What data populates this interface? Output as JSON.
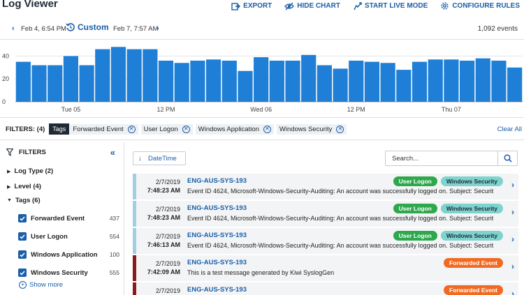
{
  "header": {
    "title": "Log Viewer",
    "actions": [
      {
        "label": "EXPORT",
        "icon": "export-icon"
      },
      {
        "label": "HIDE CHART",
        "icon": "hide-chart-icon"
      },
      {
        "label": "START LIVE MODE",
        "icon": "live-mode-icon"
      },
      {
        "label": "CONFIGURE RULES",
        "icon": "gear-icon"
      }
    ]
  },
  "date_range": {
    "start": "Feb 4, 6:54 PM",
    "mode": "Custom",
    "end": "Feb 7, 7:57 AM",
    "events": "1,092 events"
  },
  "chart_data": {
    "type": "bar",
    "color": "#1f7fd6",
    "ylim": [
      0,
      50
    ],
    "yticks": [
      0,
      20,
      40
    ],
    "xtick_labels": [
      {
        "label": "Tue 05",
        "index": 3.5
      },
      {
        "label": "12 PM",
        "index": 9.5
      },
      {
        "label": "Wed 06",
        "index": 15.5
      },
      {
        "label": "12 PM",
        "index": 21.5
      },
      {
        "label": "Thu 07",
        "index": 27.5
      }
    ],
    "values": [
      35,
      32,
      32,
      40,
      32,
      46,
      48,
      46,
      46,
      36,
      34,
      36,
      37,
      36,
      27,
      39,
      36,
      36,
      41,
      32,
      29,
      36,
      35,
      34,
      28,
      35,
      37,
      37,
      36,
      38,
      36,
      30
    ]
  },
  "filters": {
    "label": "FILTERS: (4)",
    "group_tag": "Tags",
    "chips": [
      "Forwarded Event",
      "User Logon",
      "Windows Application",
      "Windows Security"
    ],
    "clear_all": "Clear All"
  },
  "sidebar": {
    "title": "FILTERS",
    "groups": [
      {
        "label": "Log Type (2)"
      },
      {
        "label": "Level (4)"
      },
      {
        "label": "Tags (6)"
      }
    ],
    "tag_items": [
      {
        "label": "Forwarded Event",
        "count": "437"
      },
      {
        "label": "User Logon",
        "count": "554"
      },
      {
        "label": "Windows Application",
        "count": "100"
      },
      {
        "label": "Windows Security",
        "count": "555"
      }
    ],
    "show_more": "Show more"
  },
  "list": {
    "sort_label": "DateTime",
    "search_placeholder": "Search...",
    "rows": [
      {
        "date": "2/7/2019",
        "time": "7:48:23 AM",
        "host": "ENG-AUS-SYS-193",
        "message": "Event ID 4624, Microsoft-Windows-Security-Auditing: An account was successfully logged on. Subject: Securit",
        "badges": [
          "User Logon",
          "Windows Security"
        ],
        "level_color": "#9fcfe0"
      },
      {
        "date": "2/7/2019",
        "time": "7:48:23 AM",
        "host": "ENG-AUS-SYS-193",
        "message": "Event ID 4624, Microsoft-Windows-Security-Auditing: An account was successfully logged on. Subject: Securit",
        "badges": [
          "User Logon",
          "Windows Security"
        ],
        "level_color": "#9fcfe0"
      },
      {
        "date": "2/7/2019",
        "time": "7:46:13 AM",
        "host": "ENG-AUS-SYS-193",
        "message": "Event ID 4624, Microsoft-Windows-Security-Auditing: An account was successfully logged on. Subject: Securit",
        "badges": [
          "User Logon",
          "Windows Security"
        ],
        "level_color": "#9fcfe0"
      },
      {
        "date": "2/7/2019",
        "time": "7:42:09 AM",
        "host": "ENG-AUS-SYS-193",
        "message": "This is a test message generated by Kiwi SyslogGen",
        "badges": [
          "Forwarded Event"
        ],
        "level_color": "#8b1a1a"
      },
      {
        "date": "2/7/2019",
        "time": "",
        "host": "ENG-AUS-SYS-193",
        "message": "",
        "badges": [
          "Forwarded Event"
        ],
        "level_color": "#8b1a1a"
      }
    ]
  }
}
